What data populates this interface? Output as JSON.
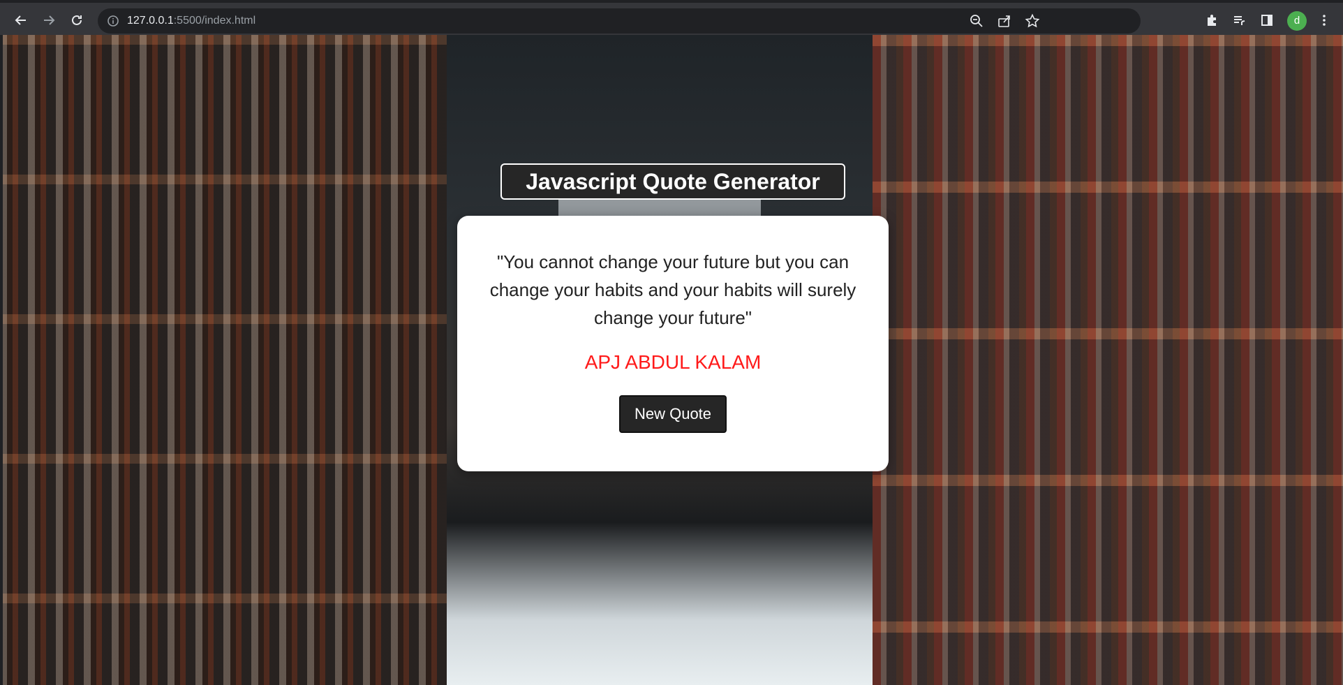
{
  "browser": {
    "url_host": "127.0.0.1",
    "url_rest": ":5500/index.html",
    "profile_initial": "d",
    "icons": {
      "back": "arrow-left-icon",
      "forward": "arrow-right-icon",
      "reload": "reload-icon",
      "site_info": "info-icon",
      "zoom": "zoom-icon",
      "share": "share-icon",
      "bookmark": "star-icon",
      "extensions": "puzzle-icon",
      "media": "playlist-icon",
      "side_panel": "side-panel-icon",
      "menu": "kebab-menu-icon"
    },
    "colors": {
      "chrome": "#35363a",
      "omnibox": "#202124",
      "avatar": "#4caf50"
    }
  },
  "page": {
    "title": "Javascript Quote Generator",
    "quote": "\"You cannot change your future but you can change your habits and your habits will surely change your future\"",
    "author": "APJ ABDUL KALAM",
    "button_label": "New Quote",
    "colors": {
      "author": "#ff1a1a",
      "card": "#ffffff",
      "button": "#262626",
      "title_bg": "#262626"
    }
  }
}
